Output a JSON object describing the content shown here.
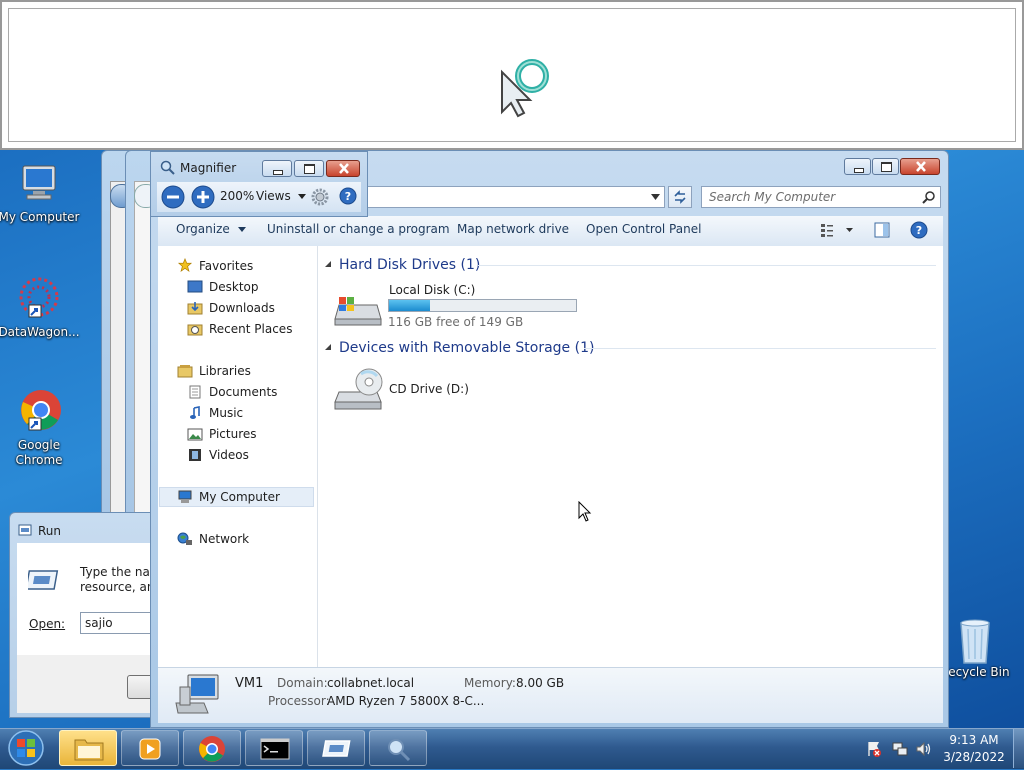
{
  "desktop": {
    "icons": [
      {
        "label": "My Computer"
      },
      {
        "label": "DataWagon..."
      },
      {
        "label": "Google Chrome"
      },
      {
        "label": "Recycle Bin"
      }
    ]
  },
  "magnifier": {
    "title": "Magnifier",
    "zoom": "200%",
    "views_label": "Views"
  },
  "explorer": {
    "search_placeholder": "Search My Computer",
    "commands": {
      "organize": "Organize",
      "uninstall": "Uninstall or change a program",
      "map_drive": "Map network drive",
      "control_panel": "Open Control Panel"
    },
    "nav": {
      "favorites": "Favorites",
      "desktop": "Desktop",
      "downloads": "Downloads",
      "recent": "Recent Places",
      "libraries": "Libraries",
      "documents": "Documents",
      "music": "Music",
      "pictures": "Pictures",
      "videos": "Videos",
      "my_computer": "My Computer",
      "network": "Network"
    },
    "hard_disks_header": "Hard Disk Drives (1)",
    "removable_header": "Devices with Removable Storage (1)",
    "local_disk": {
      "name": "Local Disk (C:)",
      "free_text": "116 GB free of 149 GB",
      "used_fraction": 0.22
    },
    "cd_drive": {
      "name": "CD Drive (D:)"
    },
    "details": {
      "name": "VM1",
      "domain_label": "Domain:",
      "domain_value": "collabnet.local",
      "memory_label": "Memory:",
      "memory_value": "8.00 GB",
      "processor_label": "Processor:",
      "processor_value": "AMD Ryzen 7 5800X 8-C..."
    }
  },
  "run_dialog": {
    "title": "Run",
    "description_line1": "Type the nam",
    "description_line2": "resource, and",
    "open_label": "Open:",
    "open_value": "sajio"
  },
  "clock": {
    "time": "9:13 AM",
    "date": "3/28/2022"
  },
  "colors": {
    "accent_blue": "#1e3a8a",
    "progress_fill": "#26a0da"
  }
}
